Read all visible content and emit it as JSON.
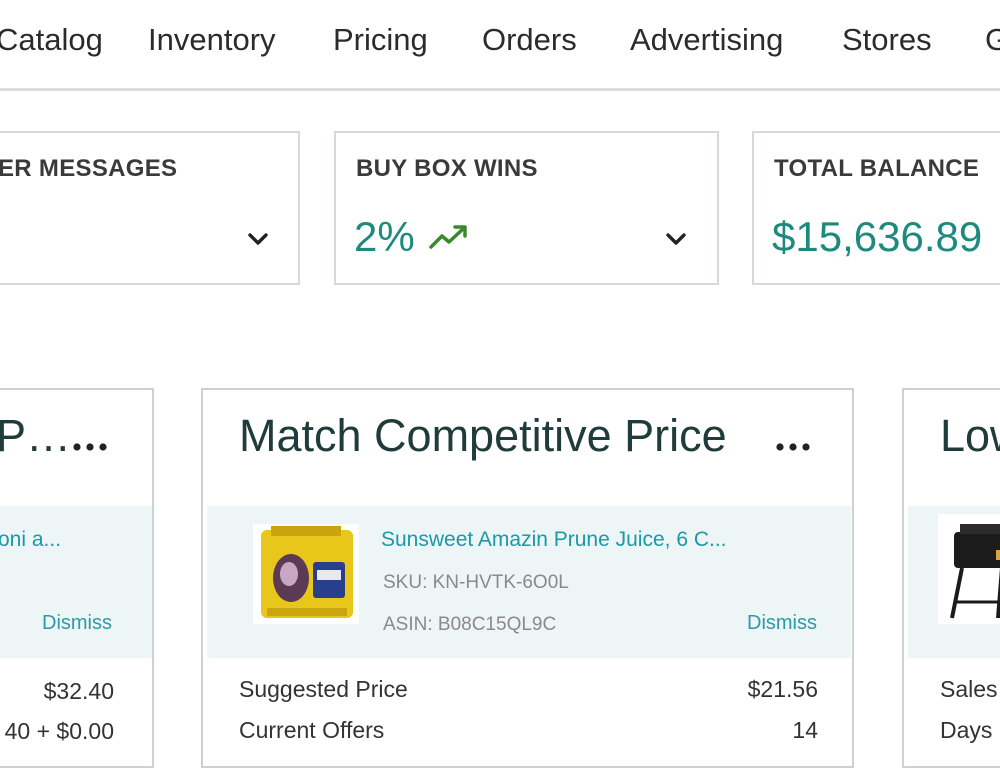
{
  "nav": {
    "items": [
      "Catalog",
      "Inventory",
      "Pricing",
      "Orders",
      "Advertising",
      "Stores",
      "G"
    ]
  },
  "metrics": {
    "messages": {
      "title": "ER MESSAGES"
    },
    "buybox": {
      "title": "BUY BOX WINS",
      "value": "2%"
    },
    "balance": {
      "title": "TOTAL BALANCE",
      "value": "$15,636.89"
    }
  },
  "cards": {
    "left": {
      "title": "P…",
      "product_fragment": "oni a...",
      "dismiss": "Dismiss",
      "value1": "$32.40",
      "value2": "40 + $0.00"
    },
    "middle": {
      "title": "Match Competitive Price",
      "product": "Sunsweet Amazin Prune Juice, 6 C...",
      "sku": "SKU: KN-HVTK-6O0L",
      "asin": "ASIN: B08C15QL9C",
      "dismiss": "Dismiss",
      "suggested_label": "Suggested Price",
      "suggested_value": "$21.56",
      "offers_label": "Current Offers",
      "offers_value": "14"
    },
    "right": {
      "title": "Low",
      "sales_label": "Sales",
      "days_label": "Days"
    }
  },
  "colors": {
    "accent": "#1e8a7d",
    "link": "#1a9aa5",
    "trend": "#3a8a2a"
  },
  "icons": [
    "chevron-down-icon",
    "trend-up-icon",
    "more-options-icon"
  ]
}
